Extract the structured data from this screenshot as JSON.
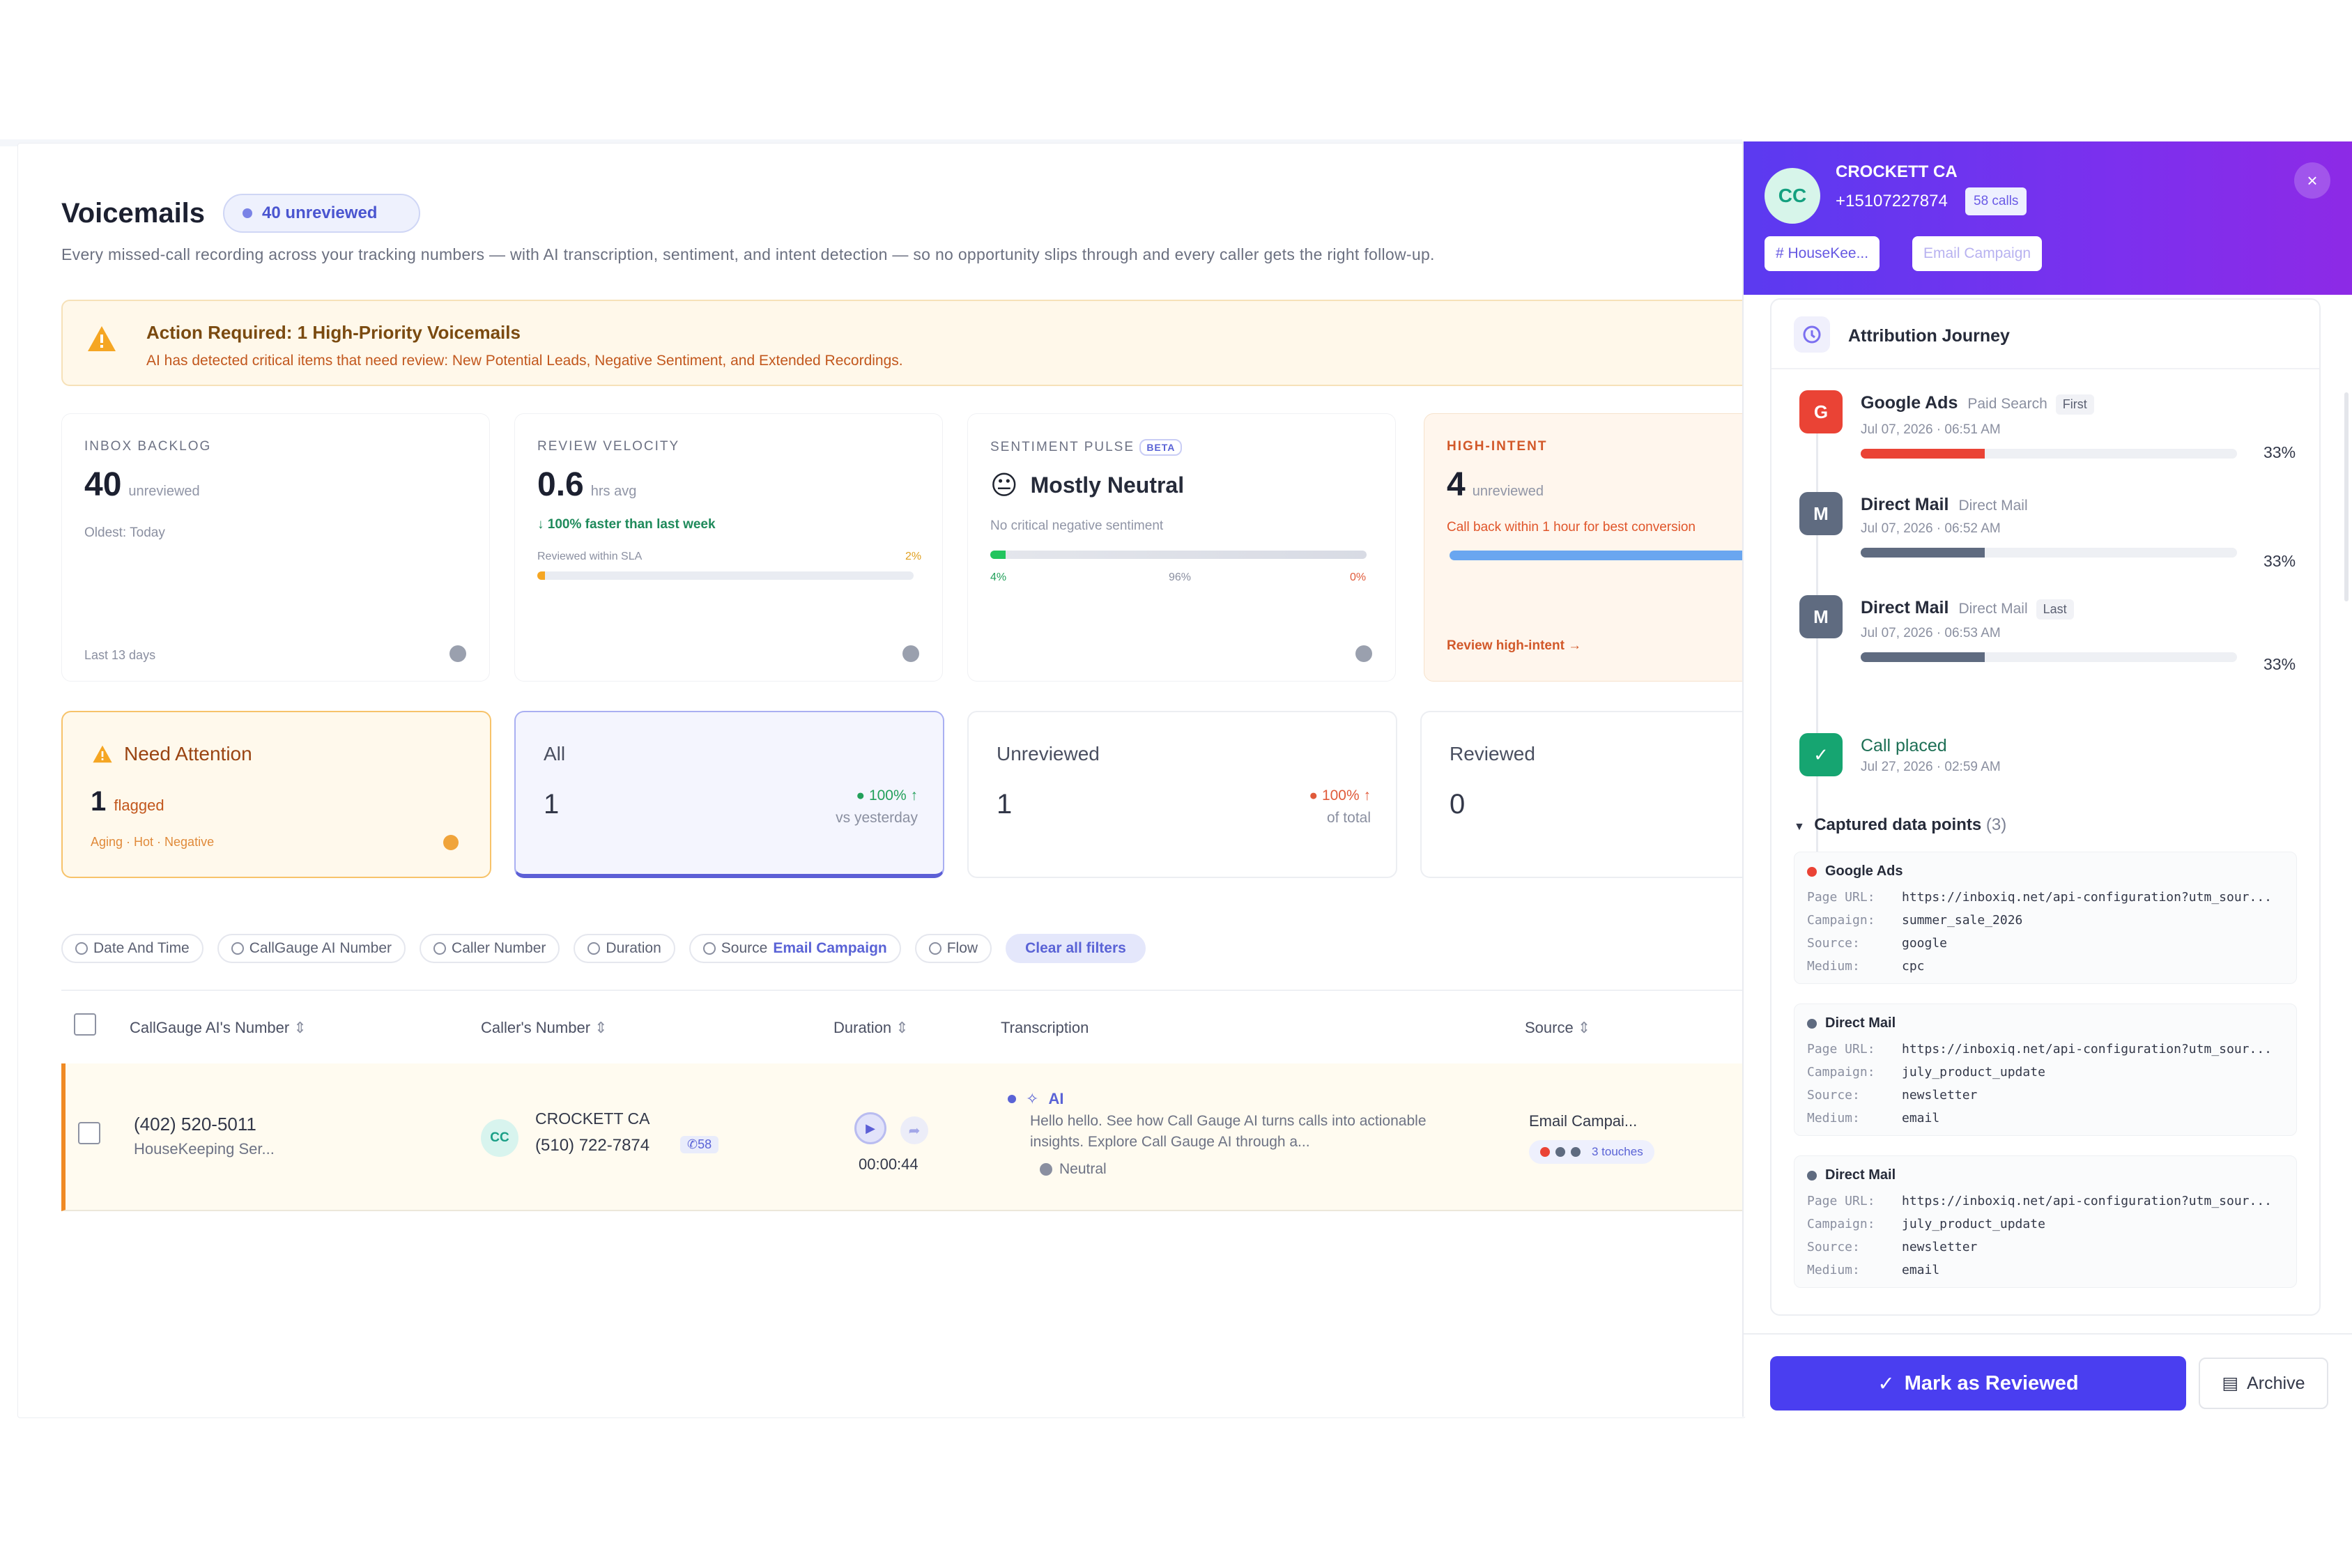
{
  "header": {
    "title": "Voicemails",
    "unreviewed_pill": "40 unreviewed",
    "subtitle": "Every missed-call recording across your tracking numbers — with AI transcription, sentiment, and intent detection — so no opportunity slips through and every caller gets the right follow-up."
  },
  "alert": {
    "title": "Action Required: 1 High-Priority Voicemails",
    "text": "AI has detected critical items that need review: New Potential Leads, Negative Sentiment, and Extended Recordings."
  },
  "kpis": {
    "inbox": {
      "label": "INBOX BACKLOG",
      "value": "40",
      "unit": "unreviewed",
      "note": "Oldest: Today",
      "footer": "Last 13 days"
    },
    "velocity": {
      "label": "REVIEW VELOCITY",
      "value": "0.6",
      "unit": "hrs avg",
      "trend": "↓ 100% faster than last week",
      "bar_label": "Reviewed within SLA",
      "bar_pct_text": "2%",
      "bar_pct": 0.02
    },
    "sentiment": {
      "label": "SENTIMENT PULSE",
      "badge": "BETA",
      "emoji": "😐",
      "value": "Mostly Neutral",
      "note": "No critical negative sentiment",
      "pos": "4%",
      "neu": "96%",
      "neg": "0%",
      "pos_frac": 0.04
    },
    "intent": {
      "label": "HIGH-INTENT",
      "value": "4",
      "unit": "unreviewed",
      "note": "Call back within 1 hour for best conversion",
      "link": "Review high-intent →",
      "bar_frac": 1.0
    }
  },
  "tabs": [
    {
      "title": "Need Attention",
      "value": "1",
      "unit": "flagged",
      "note": "Aging · Hot · Negative"
    },
    {
      "title": "All",
      "value": "1",
      "trend": "● 100% ↑",
      "trend_sub": "vs yesterday"
    },
    {
      "title": "Unreviewed",
      "value": "1",
      "trend": "● 100% ↑",
      "trend_sub": "of total"
    },
    {
      "title": "Reviewed",
      "value": "0"
    }
  ],
  "filters": [
    "Date And Time",
    "CallGauge AI Number",
    "Caller Number",
    "Duration",
    "Source",
    "Email Campaign",
    "Flow",
    "Clear all filters"
  ],
  "table": {
    "headers": [
      "CallGauge AI's Number",
      "Caller's Number",
      "Duration",
      "Transcription",
      "Source"
    ],
    "row": {
      "tracking_number": "(402) 520-5011",
      "tracking_name": "HouseKeeping Ser...",
      "caller_initials": "CC",
      "caller_name": "CROCKETT CA",
      "caller_phone": "(510) 722-7874",
      "caller_calls": "58",
      "duration": "00:00:44",
      "ai_label": "AI",
      "transcript": "Hello hello. See how Call Gauge AI turns calls into actionable insights. Explore Call Gauge AI through a...",
      "sentiment": "Neutral",
      "source": "Email Campai...",
      "touches": "3 touches"
    }
  },
  "panel": {
    "initials": "CC",
    "name": "CROCKETT CA",
    "phone": "+15107227874",
    "calls": "58 calls",
    "tags": [
      "# HouseKee...",
      "Email Campaign"
    ],
    "journey_title": "Attribution Journey",
    "journey": [
      {
        "icon": "G",
        "color": "#ea4335",
        "name": "Google Ads",
        "sub": "Paid Search",
        "tag": "First",
        "date": "Jul 07, 2026 · 06:51 AM",
        "pct": "33%",
        "frac": 0.33,
        "bar": "#ea4335"
      },
      {
        "icon": "M",
        "color": "#5f6b80",
        "name": "Direct Mail",
        "sub": "Direct Mail",
        "tag": "",
        "date": "Jul 07, 2026 · 06:52 AM",
        "pct": "33%",
        "frac": 0.33,
        "bar": "#5f6b80"
      },
      {
        "icon": "M",
        "color": "#5f6b80",
        "name": "Direct Mail",
        "sub": "Direct Mail",
        "tag": "Last",
        "date": "Jul 07, 2026 · 06:53 AM",
        "pct": "33%",
        "frac": 0.33,
        "bar": "#5f6b80"
      }
    ],
    "call_placed": {
      "label": "Call placed",
      "date": "Jul 27, 2026 · 02:59 AM"
    },
    "captured_title": "Captured data points",
    "captured_count": "(3)",
    "captured": [
      {
        "name": "Google Ads",
        "dot": "#ea4335",
        "page_url": "https://inboxiq.net/api-configuration?utm_sour...",
        "campaign": "summer_sale_2026",
        "source": "google",
        "medium": "cpc"
      },
      {
        "name": "Direct Mail",
        "dot": "#5f6b80",
        "page_url": "https://inboxiq.net/api-configuration?utm_sour...",
        "campaign": "july_product_update",
        "source": "newsletter",
        "medium": "email"
      },
      {
        "name": "Direct Mail",
        "dot": "#5f6b80",
        "page_url": "https://inboxiq.net/api-configuration?utm_sour...",
        "campaign": "july_product_update",
        "source": "newsletter",
        "medium": "email"
      }
    ],
    "kv_labels": {
      "page_url": "Page URL:",
      "campaign": "Campaign:",
      "source": "Source:",
      "medium": "Medium:"
    },
    "mark_reviewed": "Mark as Reviewed",
    "archive": "Archive"
  }
}
